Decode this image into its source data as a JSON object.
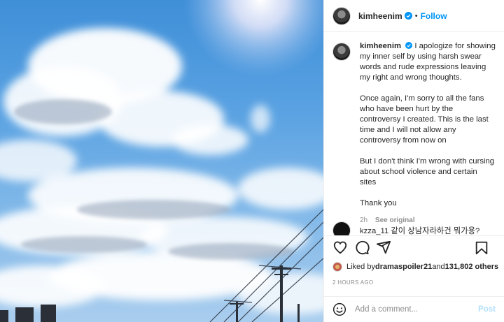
{
  "post": {
    "username": "kimheenim",
    "follow_label": "Follow",
    "separator": "•",
    "caption_paragraphs": [
      "I apologize for showing my inner self by using harsh swear words and rude expressions leaving my right and wrong thoughts.",
      "Once again, I'm sorry to all the fans who have been hurt by the controversy I created. This is the last time and I will not allow any controversy from now on",
      "But I don't think I'm wrong with cursing about school violence and certain sites",
      "Thank you"
    ],
    "caption_time": "2h",
    "see_original": "See original",
    "next_comment_text": "kzza_11 같이 상남자라하건 뭐가용?"
  },
  "likes": {
    "prefix": "Liked by ",
    "liker": "dramaspoiler21",
    "middle": " and ",
    "count": "131,802 others"
  },
  "timestamp": "2 HOURS AGO",
  "comment_input": {
    "placeholder": "Add a comment...",
    "post_label": "Post"
  },
  "icons": [
    "verified-icon",
    "heart-icon",
    "comment-icon",
    "share-icon",
    "bookmark-icon",
    "emoji-icon"
  ],
  "colors": {
    "accent": "#0095f6",
    "muted": "#8e8e8e",
    "post_disabled": "#b2dffc"
  }
}
